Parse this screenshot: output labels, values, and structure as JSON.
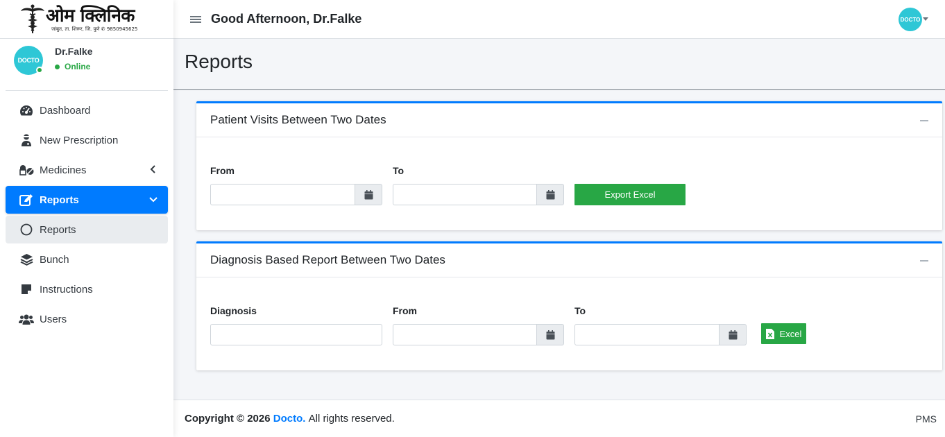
{
  "brand": {
    "title": "ओम क्लिनिक",
    "subtitle": "जांबुत, ता. शिरूर, जि. पुणे ✆ 9850945625"
  },
  "user": {
    "name": "Dr.Falke",
    "status": "Online",
    "avatar_text": "DOCTO"
  },
  "sidebar": {
    "items": [
      {
        "label": "Dashboard",
        "icon": "tachometer-icon"
      },
      {
        "label": "New Prescription",
        "icon": "user-doctor-icon"
      },
      {
        "label": "Medicines",
        "icon": "pills-icon"
      },
      {
        "label": "Reports",
        "icon": "edit-icon"
      },
      {
        "label": "Reports",
        "icon": "circle-icon"
      },
      {
        "label": "Bunch",
        "icon": "layers-icon"
      },
      {
        "label": "Instructions",
        "icon": "sticky-note-icon"
      },
      {
        "label": "Users",
        "icon": "users-icon"
      }
    ]
  },
  "navbar": {
    "greeting": "Good Afternoon, Dr.Falke",
    "avatar_text": "DOCTO"
  },
  "page": {
    "title": "Reports"
  },
  "card1": {
    "title": "Patient Visits Between Two Dates",
    "from_label": "From",
    "to_label": "To",
    "from_value": "",
    "to_value": "",
    "export_label": "Export Excel"
  },
  "card2": {
    "title": "Diagnosis Based Report Between Two Dates",
    "diagnosis_label": "Diagnosis",
    "from_label": "From",
    "to_label": "To",
    "diagnosis_value": "",
    "from_value": "",
    "to_value": "",
    "excel_label": "Excel"
  },
  "footer": {
    "copyright": "Copyright © 2026",
    "brand_link": "Docto.",
    "rights": "All rights reserved.",
    "right_text": "PMS"
  },
  "colors": {
    "primary": "#007bff",
    "success": "#28a745",
    "avatar": "#2ec7d6"
  }
}
